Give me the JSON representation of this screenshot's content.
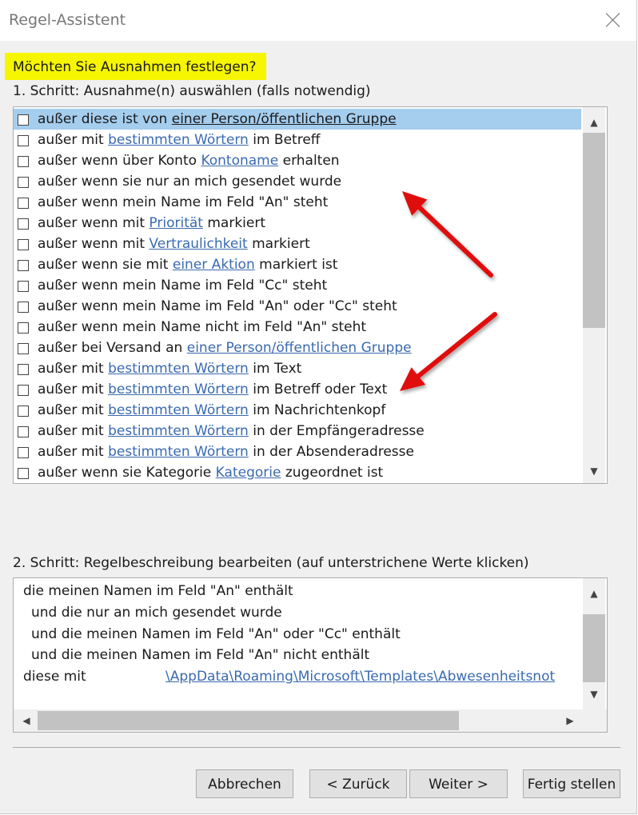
{
  "window": {
    "title": "Regel-Assistent"
  },
  "headline": "Möchten Sie Ausnahmen festlegen?",
  "step1": {
    "label": "1. Schritt: Ausnahme(n) auswählen (falls notwendig)",
    "items": [
      {
        "pre": "außer diese ist von ",
        "link": "einer Person/öffentlichen Gruppe",
        "post": "",
        "selected": true
      },
      {
        "pre": "außer mit ",
        "link": "bestimmten Wörtern",
        "post": " im Betreff"
      },
      {
        "pre": "außer wenn über Konto ",
        "link": "Kontoname",
        "post": " erhalten"
      },
      {
        "pre": "außer wenn sie nur an mich gesendet wurde",
        "link": "",
        "post": ""
      },
      {
        "pre": "außer wenn mein Name im Feld \"An\" steht",
        "link": "",
        "post": ""
      },
      {
        "pre": "außer wenn mit ",
        "link": "Priorität",
        "post": " markiert"
      },
      {
        "pre": "außer wenn mit ",
        "link": "Vertraulichkeit",
        "post": " markiert"
      },
      {
        "pre": "außer wenn sie mit ",
        "link": "einer Aktion",
        "post": " markiert ist"
      },
      {
        "pre": "außer wenn mein Name im Feld \"Cc\" steht",
        "link": "",
        "post": ""
      },
      {
        "pre": "außer wenn mein Name im Feld \"An\" oder \"Cc\" steht",
        "link": "",
        "post": ""
      },
      {
        "pre": "außer wenn mein Name nicht im Feld \"An\" steht",
        "link": "",
        "post": ""
      },
      {
        "pre": "außer bei Versand an ",
        "link": "einer Person/öffentlichen Gruppe",
        "post": ""
      },
      {
        "pre": "außer mit ",
        "link": "bestimmten Wörtern",
        "post": " im Text"
      },
      {
        "pre": "außer mit ",
        "link": "bestimmten Wörtern",
        "post": " im Betreff oder Text"
      },
      {
        "pre": "außer mit ",
        "link": "bestimmten Wörtern",
        "post": " im Nachrichtenkopf"
      },
      {
        "pre": "außer mit ",
        "link": "bestimmten Wörtern",
        "post": " in der Empfängeradresse"
      },
      {
        "pre": "außer mit ",
        "link": "bestimmten Wörtern",
        "post": " in der Absenderadresse"
      },
      {
        "pre": "außer wenn sie Kategorie ",
        "link": "Kategorie",
        "post": " zugeordnet ist"
      }
    ]
  },
  "step2": {
    "label": "2. Schritt: Regelbeschreibung bearbeiten (auf unterstrichene Werte klicken)",
    "lines": [
      "die meinen Namen im Feld \"An\" enthält",
      "und die nur an mich gesendet wurde",
      "und die meinen Namen im Feld \"An\" oder \"Cc\" enthält",
      "und die meinen Namen im Feld \"An\" nicht enthält"
    ],
    "last_prefix": "diese mit",
    "last_link": "\\AppData\\Roaming\\Microsoft\\Templates\\Abwesenheitsnot"
  },
  "buttons": {
    "cancel": "Abbrechen",
    "back": "< Zurück",
    "next": "Weiter >",
    "finish": "Fertig stellen"
  },
  "icons": {
    "scroll_up": "▲",
    "scroll_down": "▼",
    "scroll_left": "◀",
    "scroll_right": "▶"
  },
  "colors": {
    "highlight": "#f6f600",
    "selection": "#a5cdee",
    "link": "#3a6ab0",
    "annotation_arrow": "#e01010"
  }
}
